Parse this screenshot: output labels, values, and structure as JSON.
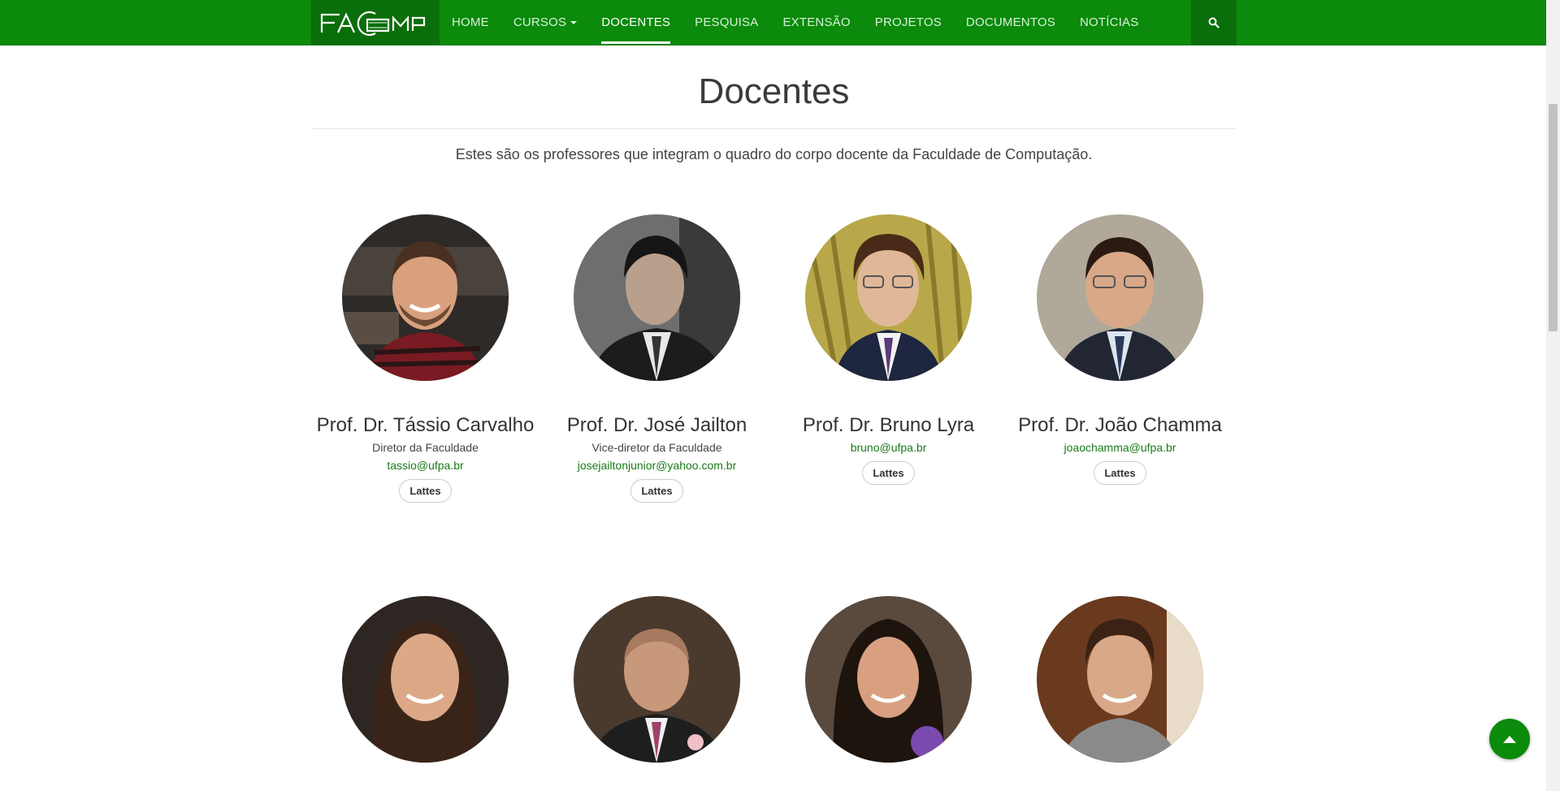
{
  "nav": {
    "brand": "FACOMP",
    "items": [
      {
        "label": "HOME"
      },
      {
        "label": "CURSOS"
      },
      {
        "label": "DOCENTES"
      },
      {
        "label": "PESQUISA"
      },
      {
        "label": "EXTENSÃO"
      },
      {
        "label": "PROJETOS"
      },
      {
        "label": "DOCUMENTOS"
      },
      {
        "label": "NOTÍCIAS"
      }
    ],
    "active": "DOCENTES",
    "search_icon": "search-icon"
  },
  "page": {
    "title": "Docentes",
    "intro": "Estes são os professores que integram o quadro do corpo docente da Faculdade de Computação."
  },
  "professors": [
    {
      "name": "Prof. Dr. Tássio Carvalho",
      "role": "Diretor da Faculdade",
      "email": "tassio@ufpa.br",
      "link": "Lattes"
    },
    {
      "name": "Prof. Dr. José Jailton",
      "role": "Vice-diretor da Faculdade",
      "email": "josejailtonjunior@yahoo.com.br",
      "link": "Lattes"
    },
    {
      "name": "Prof. Dr. Bruno Lyra",
      "role": "",
      "email": "bruno@ufpa.br",
      "link": "Lattes"
    },
    {
      "name": "Prof. Dr. João Chamma",
      "role": "",
      "email": "joaochamma@ufpa.br",
      "link": "Lattes"
    }
  ],
  "colors": {
    "nav_bg": "#0b8a0b",
    "brand_bg": "#0a6e0a",
    "link": "#1a7a1a"
  },
  "back_to_top_icon": "arrow-up-icon"
}
